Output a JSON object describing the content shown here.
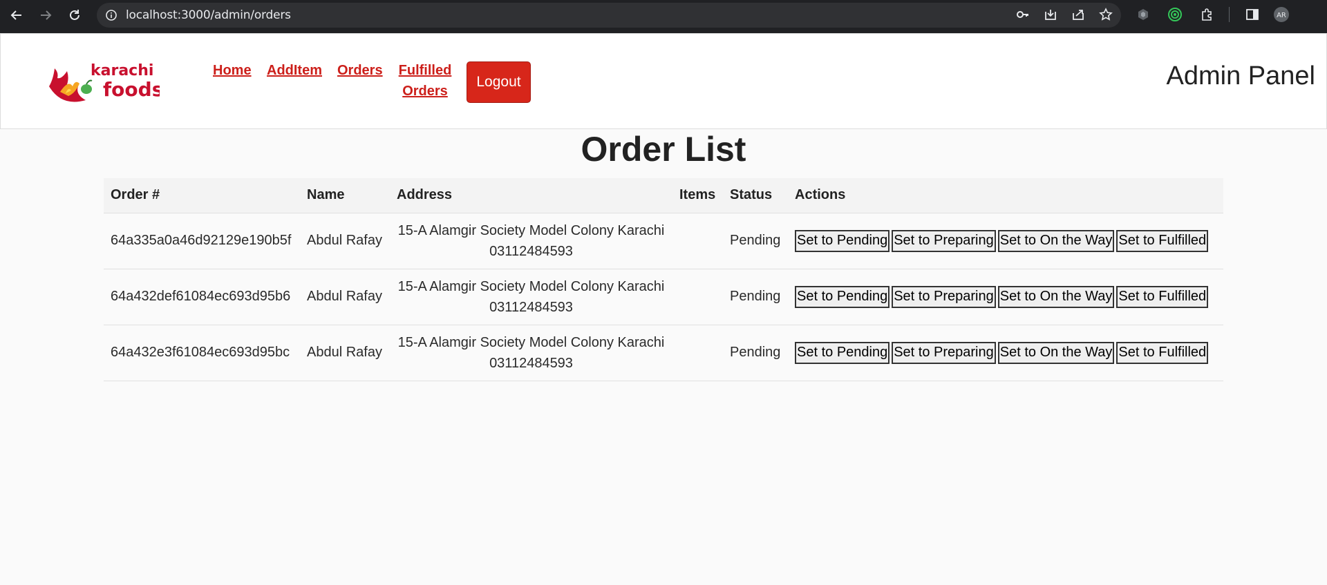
{
  "browser": {
    "url": "localhost:3000/admin/orders"
  },
  "header": {
    "logo_text_top": "karachi",
    "logo_text_bottom": "foods",
    "nav": {
      "home": "Home",
      "add_item": "AddItem",
      "orders": "Orders",
      "fulfilled_line1": "Fulfilled",
      "fulfilled_line2": "Orders"
    },
    "logout_label": "Logout",
    "admin_title": "Admin Panel"
  },
  "main": {
    "title": "Order List",
    "columns": {
      "order": "Order #",
      "name": "Name",
      "address": "Address",
      "items": "Items",
      "status": "Status",
      "actions": "Actions"
    },
    "rows": [
      {
        "id": "64a335a0a46d92129e190b5f",
        "name": "Abdul Rafay",
        "address_line1": "15-A Alamgir Society Model Colony Karachi",
        "address_line2": "03112484593",
        "items": "",
        "status": "Pending"
      },
      {
        "id": "64a432def61084ec693d95b6",
        "name": "Abdul Rafay",
        "address_line1": "15-A Alamgir Society Model Colony Karachi",
        "address_line2": "03112484593",
        "items": "",
        "status": "Pending"
      },
      {
        "id": "64a432e3f61084ec693d95bc",
        "name": "Abdul Rafay",
        "address_line1": "15-A Alamgir Society Model Colony Karachi",
        "address_line2": "03112484593",
        "items": "",
        "status": "Pending"
      }
    ],
    "actions": {
      "pending": "Set to Pending",
      "preparing": "Set to Preparing",
      "on_the_way": "Set to On the Way",
      "fulfilled": "Set to Fulfilled"
    }
  },
  "colors": {
    "brand_red": "#cc1f1a",
    "logout_bg": "#d7261a"
  },
  "icons": [
    "back-arrow-icon",
    "forward-arrow-icon",
    "reload-icon",
    "info-icon",
    "key-icon",
    "download-icon",
    "share-icon",
    "star-icon",
    "extension-a-icon",
    "extension-circle-icon",
    "puzzle-icon",
    "side-panel-icon",
    "profile-avatar-icon"
  ]
}
